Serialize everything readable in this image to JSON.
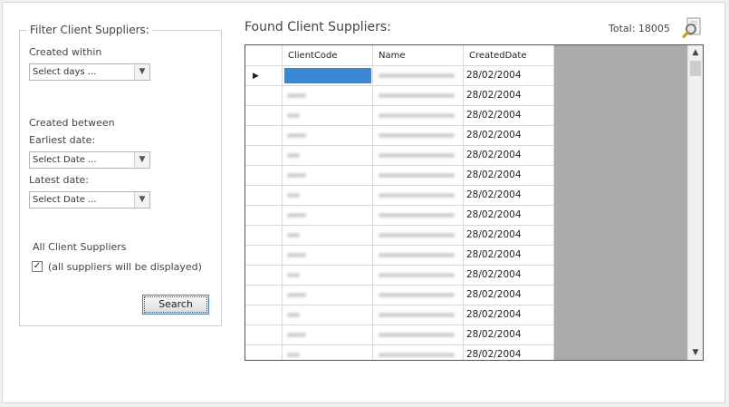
{
  "filter": {
    "legend": "Filter Client Suppliers:",
    "created_within_label": "Created within",
    "created_within_value": "Select days ...",
    "created_between_label": "Created between",
    "earliest_label": "Earliest date:",
    "earliest_value": "Select Date ...",
    "latest_label": "Latest date:",
    "latest_value": "Select Date ...",
    "all_label": "All Client Suppliers",
    "all_checkbox_label": "(all suppliers will be displayed)",
    "all_checked": true,
    "search_button": "Search"
  },
  "results": {
    "title": "Found Client Suppliers:",
    "total_label": "Total:",
    "total_value": "18005",
    "columns": [
      "ClientCode",
      "Name",
      "CreatedDate"
    ],
    "rows": [
      {
        "date": "28/02/2004"
      },
      {
        "date": "28/02/2004"
      },
      {
        "date": "28/02/2004"
      },
      {
        "date": "28/02/2004"
      },
      {
        "date": "28/02/2004"
      },
      {
        "date": "28/02/2004"
      },
      {
        "date": "28/02/2004"
      },
      {
        "date": "28/02/2004"
      },
      {
        "date": "28/02/2004"
      },
      {
        "date": "28/02/2004"
      },
      {
        "date": "28/02/2004"
      },
      {
        "date": "28/02/2004"
      },
      {
        "date": "28/02/2004"
      },
      {
        "date": "28/02/2004"
      },
      {
        "date": "28/02/2004"
      }
    ]
  },
  "icons": {
    "dropdown": "chevron-down-icon",
    "search": "magnifier-document-icon",
    "scroll_up": "chevron-up-icon",
    "scroll_down": "chevron-down-icon",
    "row_pointer": "triangle-right-icon"
  },
  "colors": {
    "selection": "#3a88d6",
    "grid_empty": "#ababab"
  }
}
